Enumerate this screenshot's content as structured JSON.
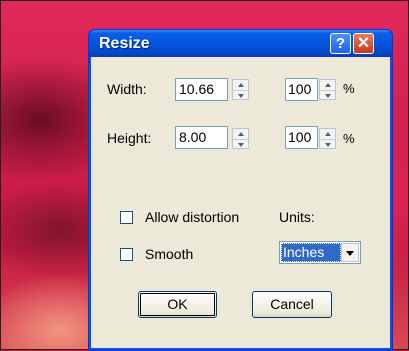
{
  "dialog": {
    "title": "Resize",
    "help_label": "?",
    "close_label": "✕"
  },
  "width": {
    "label": "Width:",
    "value": "10.66",
    "percent": "100",
    "percent_unit": "%"
  },
  "height": {
    "label": "Height:",
    "value": "8.00",
    "percent": "100",
    "percent_unit": "%"
  },
  "options": {
    "allow_distortion": {
      "label": "Allow distortion",
      "checked": false
    },
    "smooth": {
      "label": "Smooth",
      "checked": false
    }
  },
  "units": {
    "label": "Units:",
    "selected": "Inches"
  },
  "buttons": {
    "ok": "OK",
    "cancel": "Cancel"
  },
  "colors": {
    "titlebar": "#0454e0",
    "dialog_bg": "#ece9d8",
    "selection": "#316ac5"
  }
}
